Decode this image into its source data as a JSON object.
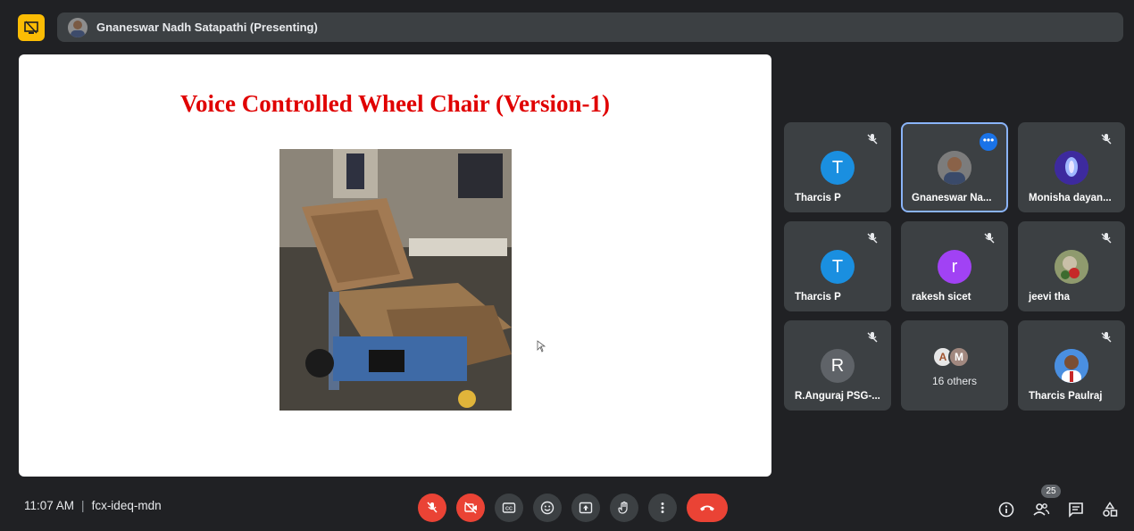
{
  "presenter": {
    "label": "Gnaneswar Nadh Satapathi (Presenting)"
  },
  "slide": {
    "title": "Voice Controlled Wheel Chair (Version-1)"
  },
  "participants": [
    {
      "name": "Tharcis P",
      "initial": "T",
      "avatar_color": "#1a8fe0",
      "muted": true
    },
    {
      "name": "Gnaneswar Na...",
      "initial": "",
      "avatar_color": "#6d6d6d",
      "muted": false,
      "active_speaker": true
    },
    {
      "name": "Monisha dayan...",
      "initial": "",
      "avatar_color": "#4a2fb0",
      "muted": true
    },
    {
      "name": "Tharcis P",
      "initial": "T",
      "avatar_color": "#1a8fe0",
      "muted": true
    },
    {
      "name": "rakesh sicet",
      "initial": "r",
      "avatar_color": "#a142f4",
      "muted": true
    },
    {
      "name": "jeevi tha",
      "initial": "",
      "avatar_color": "#7b8a5a",
      "muted": true
    },
    {
      "name": "R.Anguraj PSG-...",
      "initial": "R",
      "avatar_color": "#5f6368",
      "muted": true
    },
    {
      "name": "16 others",
      "initial": "",
      "avatar_color": "",
      "muted": false,
      "group": true
    },
    {
      "name": "Tharcis Paulraj",
      "initial": "",
      "avatar_color": "#3a7bd5",
      "muted": true
    }
  ],
  "others_avatars": [
    "A",
    "M"
  ],
  "meeting": {
    "time": "11:07 AM",
    "separator": "|",
    "code": "fcx-ideq-mdn"
  },
  "controls": [
    {
      "name": "mic-off",
      "state": "off"
    },
    {
      "name": "camera-off",
      "state": "off"
    },
    {
      "name": "captions"
    },
    {
      "name": "reactions"
    },
    {
      "name": "present"
    },
    {
      "name": "raise-hand"
    },
    {
      "name": "more-options"
    },
    {
      "name": "leave-call"
    }
  ],
  "people_count": "25",
  "colors": {
    "accent": "#8ab4f8",
    "danger": "#ea4335",
    "tile": "#3c4043",
    "bg": "#202124"
  }
}
